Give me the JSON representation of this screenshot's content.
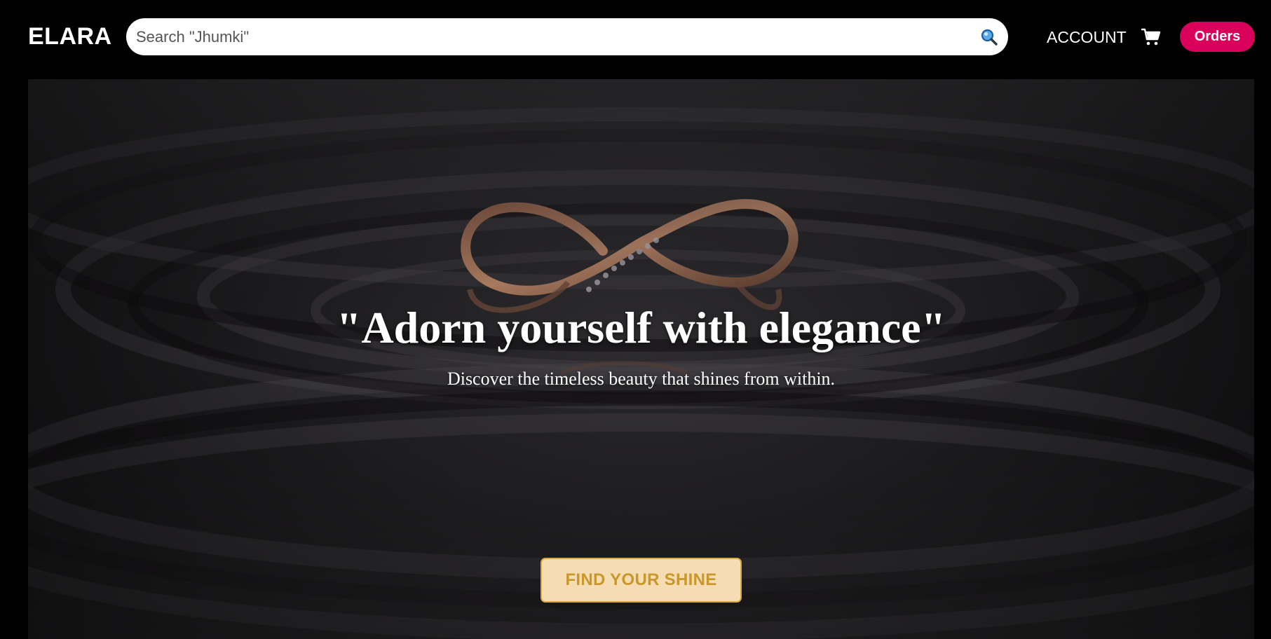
{
  "header": {
    "logo": "ELARA",
    "search_placeholder": "Search \"Jhumki\"",
    "search_icon": "search-icon",
    "account_label": "ACCOUNT",
    "cart_icon": "cart-icon",
    "orders_label": "Orders"
  },
  "hero": {
    "title": "\"Adorn yourself with elegance\"",
    "subtitle": "Discover the timeless beauty that shines from within.",
    "cta_label": "FIND YOUR SHINE",
    "background_image": "infinity ring on dark water"
  },
  "colors": {
    "page_background": "#000000",
    "orders_button": "#d9005b",
    "cta_background": "#f5dcb2",
    "cta_text": "#c9982a",
    "cta_border": "#d9ab3f"
  }
}
